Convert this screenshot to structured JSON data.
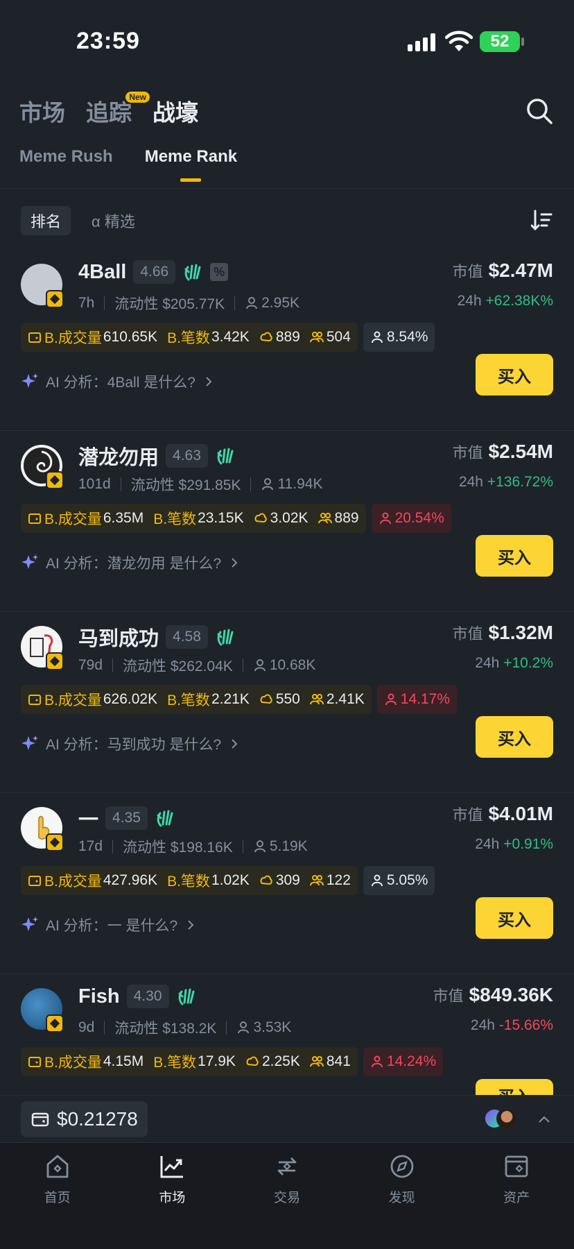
{
  "status_bar": {
    "time": "23:59",
    "battery": "52"
  },
  "top_nav": {
    "tabs": [
      {
        "label": "市场",
        "active": false
      },
      {
        "label": "追踪",
        "active": false,
        "badge": "New"
      },
      {
        "label": "战壕",
        "active": true
      }
    ]
  },
  "sub_tabs": [
    {
      "label": "Meme Rush",
      "active": false
    },
    {
      "label": "Meme Rank",
      "active": true
    }
  ],
  "filters": [
    {
      "label": "排名",
      "active": true
    },
    {
      "label": "α 精选",
      "active": false
    }
  ],
  "tokens": [
    {
      "name": "4Ball",
      "score": "4.66",
      "age": "7h",
      "liquidity": "流动性 $205.77K",
      "holders": "2.95K",
      "mcap_label": "市值",
      "mcap": "$2.47M",
      "change_label": "24h",
      "change": "+62.38K%",
      "change_dir": "pos",
      "vol_label": "B.成交量",
      "vol": "610.65K",
      "tx_label": "B.笔数",
      "tx": "3.42K",
      "s1": "889",
      "s2": "504",
      "top10": "8.54%",
      "top10_red": false,
      "ai": "AI 分析：4Ball 是什么?",
      "buy": "买入",
      "avatar_color": "#c5cad3",
      "has_pct": true
    },
    {
      "name": "潜龙勿用",
      "score": "4.63",
      "age": "101d",
      "liquidity": "流动性 $291.85K",
      "holders": "11.94K",
      "mcap_label": "市值",
      "mcap": "$2.54M",
      "change_label": "24h",
      "change": "+136.72%",
      "change_dir": "pos",
      "vol_label": "B.成交量",
      "vol": "6.35M",
      "tx_label": "B.笔数",
      "tx": "23.15K",
      "s1": "3.02K",
      "s2": "889",
      "top10": "20.54%",
      "top10_red": true,
      "ai": "AI 分析：潜龙勿用 是什么?",
      "buy": "买入",
      "avatar_color": "#222222",
      "has_pct": false
    },
    {
      "name": "马到成功",
      "score": "4.58",
      "age": "79d",
      "liquidity": "流动性 $262.04K",
      "holders": "10.68K",
      "mcap_label": "市值",
      "mcap": "$1.32M",
      "change_label": "24h",
      "change": "+10.2%",
      "change_dir": "pos",
      "vol_label": "B.成交量",
      "vol": "626.02K",
      "tx_label": "B.笔数",
      "tx": "2.21K",
      "s1": "550",
      "s2": "2.41K",
      "top10": "14.17%",
      "top10_red": true,
      "ai": "AI 分析：马到成功 是什么?",
      "buy": "买入",
      "avatar_color": "#f4f4f4",
      "has_pct": false
    },
    {
      "name": "一",
      "score": "4.35",
      "age": "17d",
      "liquidity": "流动性 $198.16K",
      "holders": "5.19K",
      "mcap_label": "市值",
      "mcap": "$4.01M",
      "change_label": "24h",
      "change": "+0.91%",
      "change_dir": "pos",
      "vol_label": "B.成交量",
      "vol": "427.96K",
      "tx_label": "B.笔数",
      "tx": "1.02K",
      "s1": "309",
      "s2": "122",
      "top10": "5.05%",
      "top10_red": false,
      "ai": "AI 分析：一 是什么?",
      "buy": "买入",
      "avatar_color": "#f6f6f6",
      "has_pct": false
    },
    {
      "name": "Fish",
      "score": "4.30",
      "age": "9d",
      "liquidity": "流动性 $138.2K",
      "holders": "3.53K",
      "mcap_label": "市值",
      "mcap": "$849.36K",
      "change_label": "24h",
      "change": "-15.66%",
      "change_dir": "neg",
      "vol_label": "B.成交量",
      "vol": "4.15M",
      "tx_label": "B.笔数",
      "tx": "17.9K",
      "s1": "2.25K",
      "s2": "841",
      "top10": "14.24%",
      "top10_red": true,
      "ai": "",
      "buy": "买入",
      "avatar_color": "#2e6fa8",
      "has_pct": false
    }
  ],
  "wallet": {
    "balance": "$0.21278"
  },
  "bottom_nav": [
    {
      "label": "首页",
      "icon": "home-icon",
      "active": false
    },
    {
      "label": "市场",
      "icon": "market-chart-icon",
      "active": true
    },
    {
      "label": "交易",
      "icon": "trade-icon",
      "active": false
    },
    {
      "label": "发现",
      "icon": "discover-icon",
      "active": false
    },
    {
      "label": "资产",
      "icon": "wallet-icon",
      "active": false
    }
  ],
  "colors": {
    "accent": "#f0b90b",
    "buy": "#fcd535",
    "up": "#2ebd85",
    "down": "#f6465d",
    "bg": "#1e2329"
  }
}
